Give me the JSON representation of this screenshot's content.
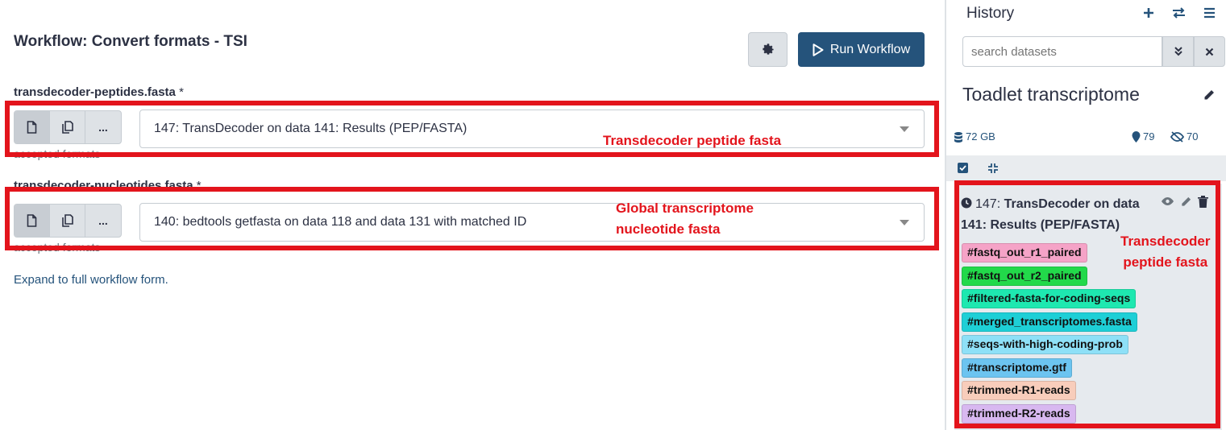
{
  "workflow": {
    "title": "Workflow: Convert formats - TSI",
    "run_label": "Run Workflow",
    "expand_link": "Expand to full workflow form."
  },
  "inputs": [
    {
      "label": "transdecoder-peptides.fasta",
      "required_mark": "*",
      "selected": "147: TransDecoder on data 141: Results (PEP/FASTA)",
      "help": "accepted formats",
      "buttons": [
        "file-icon",
        "copy-icon",
        "..."
      ]
    },
    {
      "label": "transdecoder-nucleotides.fasta",
      "required_mark": "*",
      "selected": "140: bedtools getfasta on data 118 and data 131 with matched ID",
      "help": "accepted formats",
      "buttons": [
        "file-icon",
        "copy-icon",
        "..."
      ]
    }
  ],
  "annotations": {
    "peptide": "Transdecoder peptide fasta",
    "global_line1": "Global transcriptome",
    "global_line2": "nucleotide fasta",
    "history_line1": "Transdecoder",
    "history_line2": "peptide fasta"
  },
  "history": {
    "panel_title": "History",
    "search_placeholder": "search datasets",
    "name": "Toadlet transcriptome",
    "size": "72 GB",
    "shown_count": "79",
    "hidden_count": "70",
    "dataset": {
      "hid": "147:",
      "name": "TransDecoder on data 141: Results (PEP/FASTA)",
      "tags": [
        {
          "text": "#fastq_out_r1_paired",
          "color": "#f5a3c7"
        },
        {
          "text": "#fastq_out_r2_paired",
          "color": "#22d94a"
        },
        {
          "text": "#filtered-fasta-for-coding-seqs",
          "color": "#1ee8b0"
        },
        {
          "text": "#merged_transcriptomes.fasta",
          "color": "#1ecfd6"
        },
        {
          "text": "#seqs-with-high-coding-prob",
          "color": "#8ee0f7"
        },
        {
          "text": "#transcriptome.gtf",
          "color": "#6cc4f0"
        },
        {
          "text": "#trimmed-R1-reads",
          "color": "#f8cdbb"
        },
        {
          "text": "#trimmed-R2-reads",
          "color": "#d8b8f0"
        }
      ]
    }
  },
  "colors": {
    "accent": "#25537b",
    "annotation_red": "#e3141c"
  }
}
